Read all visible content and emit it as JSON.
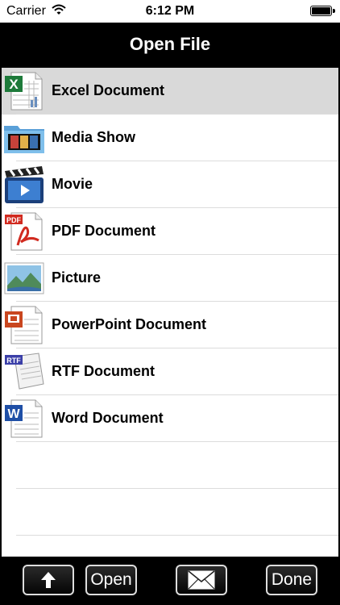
{
  "status_bar": {
    "carrier": "Carrier",
    "time": "6:12 PM"
  },
  "navbar": {
    "title": "Open File"
  },
  "file_types": [
    {
      "label": "Excel Document",
      "icon": "excel-document-icon",
      "selected": true
    },
    {
      "label": "Media Show",
      "icon": "media-show-icon",
      "selected": false
    },
    {
      "label": "Movie",
      "icon": "movie-icon",
      "selected": false
    },
    {
      "label": "PDF Document",
      "icon": "pdf-document-icon",
      "selected": false
    },
    {
      "label": "Picture",
      "icon": "picture-icon",
      "selected": false
    },
    {
      "label": "PowerPoint Document",
      "icon": "powerpoint-document-icon",
      "selected": false
    },
    {
      "label": "RTF Document",
      "icon": "rtf-document-icon",
      "selected": false
    },
    {
      "label": "Word Document",
      "icon": "word-document-icon",
      "selected": false
    }
  ],
  "icon_badges": {
    "pdf": "PDF",
    "rtf": "RTF"
  },
  "toolbar": {
    "share_icon": "up-arrow-icon",
    "open_label": "Open",
    "mail_icon": "envelope-icon",
    "done_label": "Done"
  },
  "colors": {
    "navbar": "#000000",
    "selected_row": "#d9d9d9",
    "separator": "#dcdcdc"
  }
}
